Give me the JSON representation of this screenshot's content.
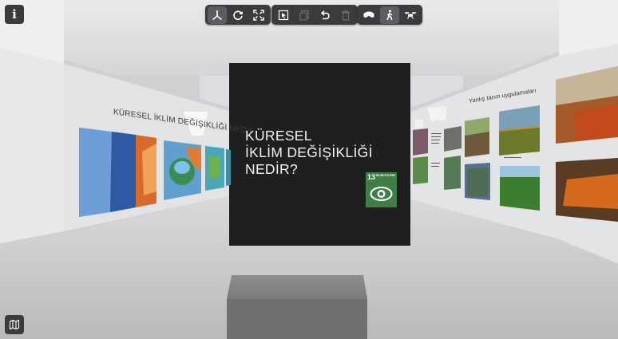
{
  "toolbar": {
    "navigation_group": [
      {
        "icon": "axes-icon",
        "active": true
      },
      {
        "icon": "orbit-icon",
        "active": false
      },
      {
        "icon": "fullscreen-icon",
        "active": false
      }
    ],
    "edit_group": [
      {
        "icon": "select-icon",
        "enabled": true
      },
      {
        "icon": "copy-icon",
        "enabled": false
      },
      {
        "icon": "undo-icon",
        "enabled": true
      },
      {
        "icon": "delete-icon",
        "enabled": false
      }
    ],
    "mode_group": [
      {
        "icon": "vr-headset-icon",
        "active": false
      },
      {
        "icon": "walk-icon",
        "active": true
      },
      {
        "icon": "drone-icon",
        "active": false
      }
    ]
  },
  "center_panel": {
    "title_line1": "KÜRESEL",
    "title_line2": "İKLİM DEĞİŞİKLİĞİ",
    "title_line3": "NEDİR?",
    "sdg_badge": {
      "number": "13",
      "label": "İKLİM EYLEMİ",
      "color": "#3f7e44"
    }
  },
  "left_wall": {
    "label": "KÜRESEL İKLİM DEĞİŞİKLİĞİ NEDİR"
  },
  "right_wall": {
    "label": "Yanlış tarım uygulamaları"
  },
  "colors": {
    "toolbar_bg": "#3a3b3d",
    "panel_bg": "#1f1f1f",
    "wall": "#e4e5e7",
    "floor": "#c9cacc"
  }
}
